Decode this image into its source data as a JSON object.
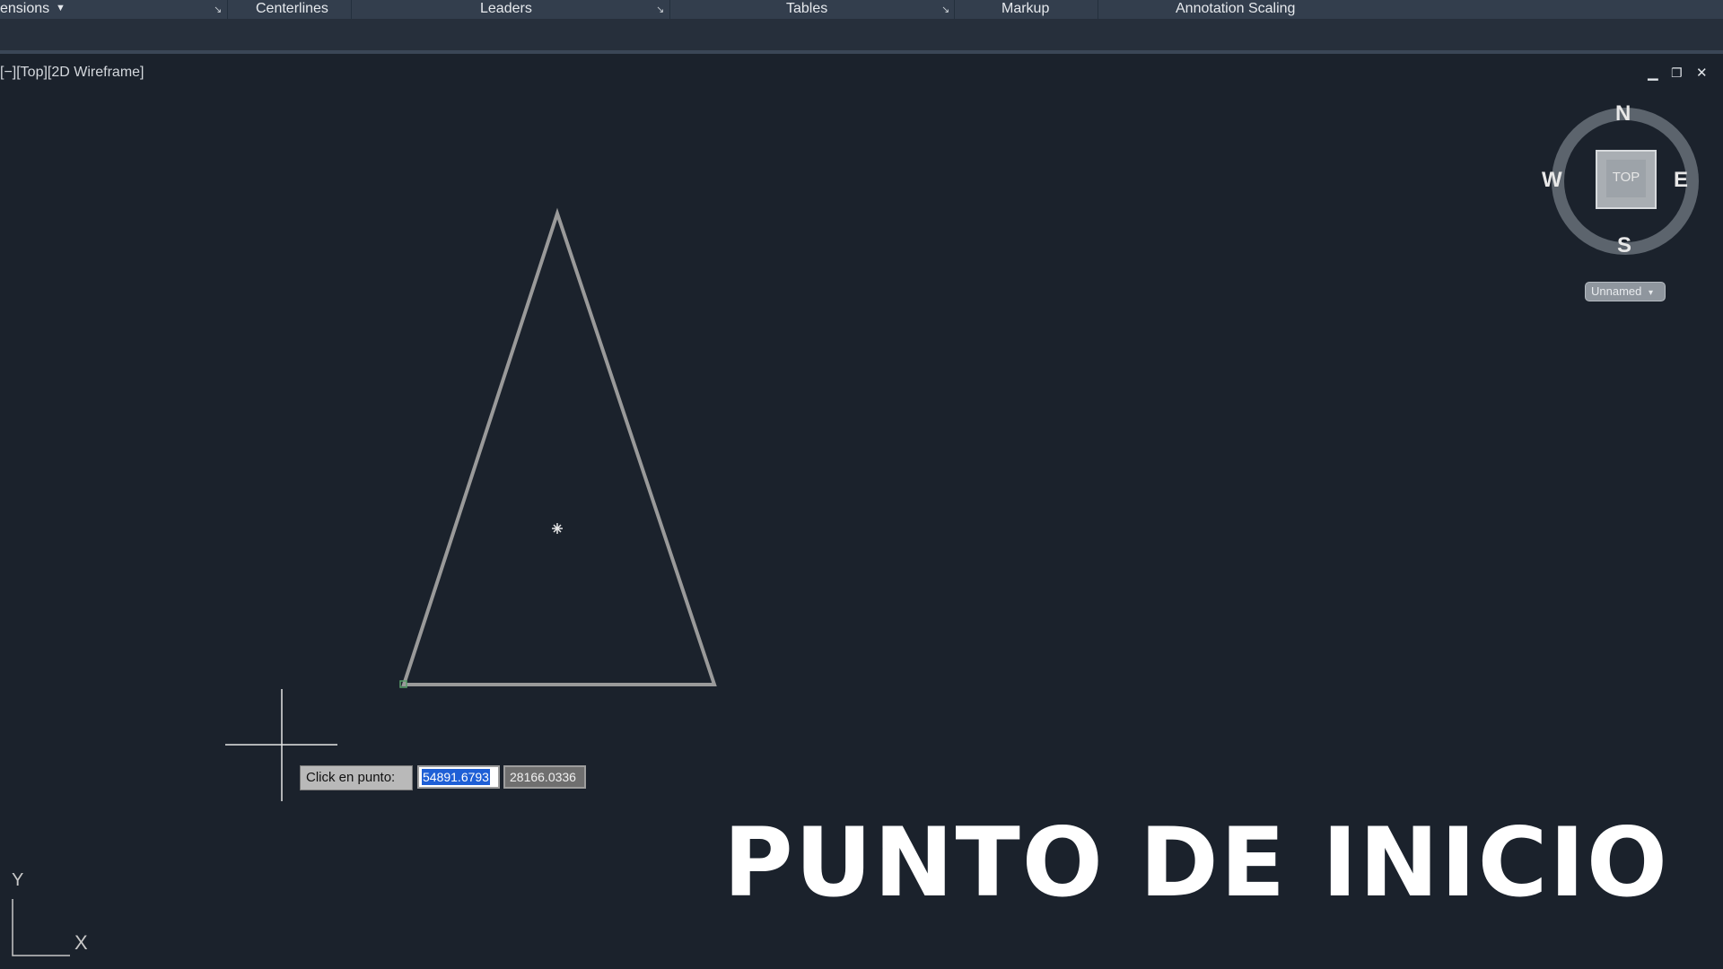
{
  "ribbon": {
    "panels": [
      {
        "label": "ensions",
        "has_dropdown": true
      },
      {
        "label": "Centerlines"
      },
      {
        "label": "Leaders",
        "has_launcher": true
      },
      {
        "label": "Tables",
        "has_launcher": true
      },
      {
        "label": "Markup"
      },
      {
        "label": "Annotation Scaling"
      }
    ]
  },
  "viewport": {
    "label": "[−][Top][2D Wireframe]",
    "window_controls": [
      "minimize",
      "restore",
      "close"
    ]
  },
  "viewcube": {
    "face": "TOP",
    "compass": {
      "n": "N",
      "s": "S",
      "e": "E",
      "w": "W"
    },
    "ucs_button": "Unnamed"
  },
  "dynamic_input": {
    "prompt": "Click en punto:",
    "x_value": "54891.6793",
    "y_value": "28166.0336"
  },
  "ucs_icon": {
    "x_label": "X",
    "y_label": "Y"
  },
  "caption": "PUNTO DE INICIO",
  "colors": {
    "background": "#1b222c",
    "ribbon": "#333e4d",
    "geometry": "#9a9a9a",
    "selection": "#1e5fd6"
  }
}
